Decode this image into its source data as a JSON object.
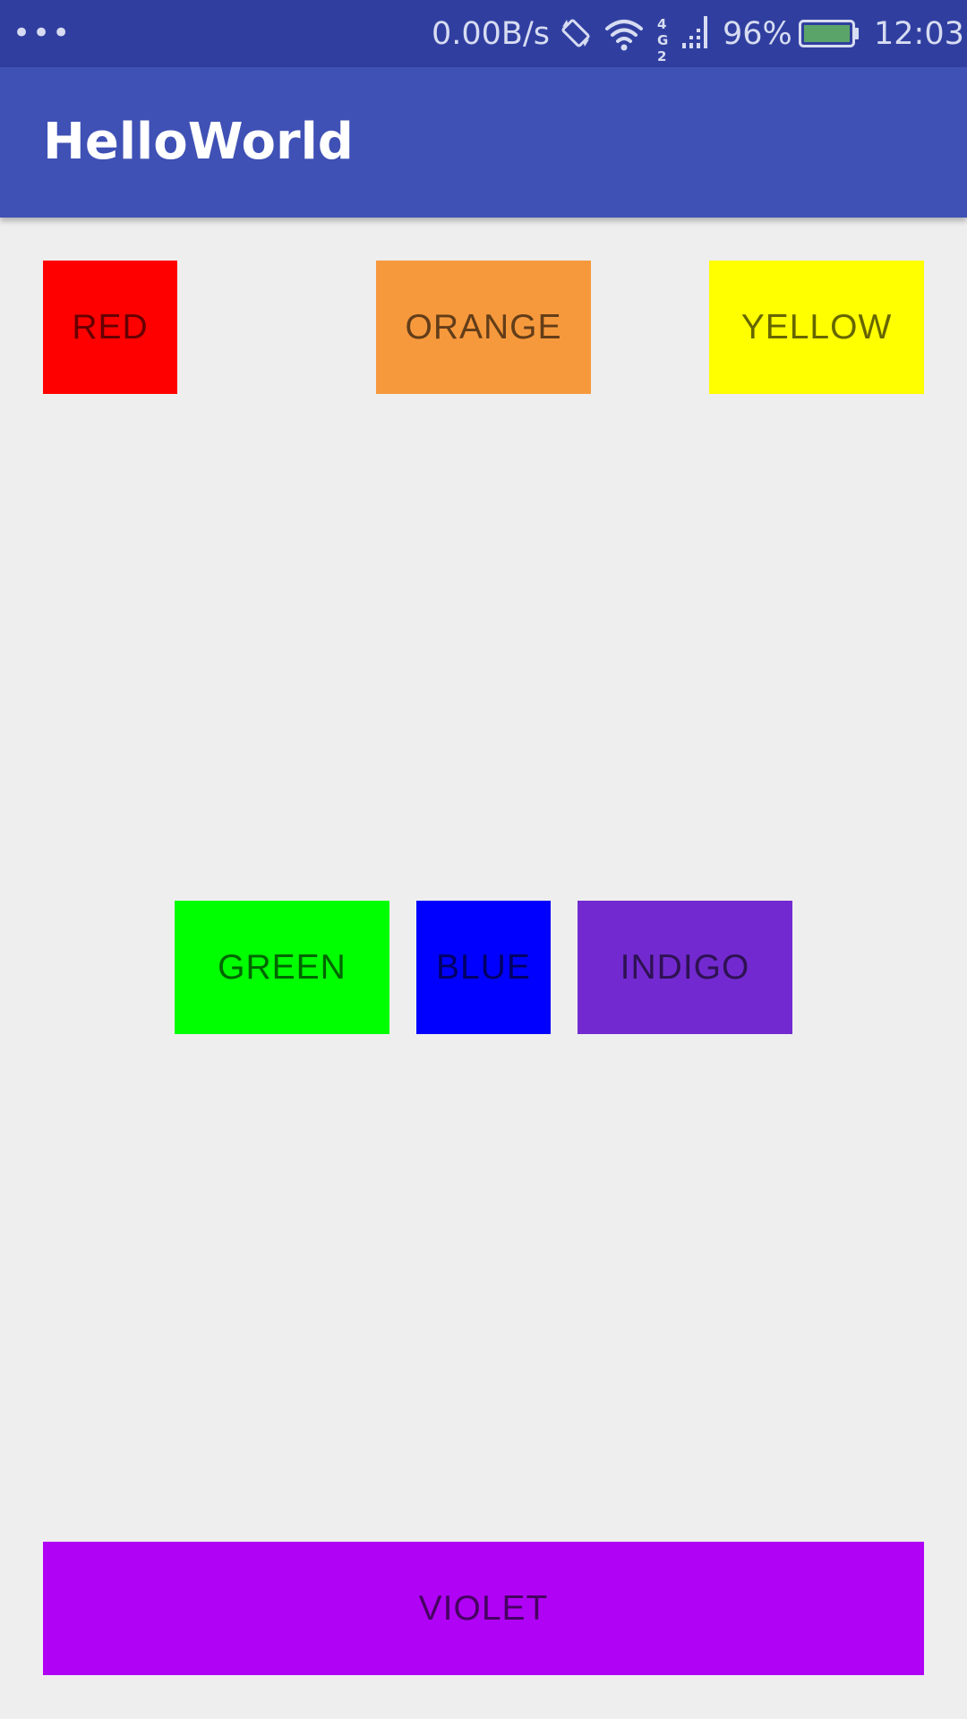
{
  "status_bar": {
    "menu_dots": "•••",
    "network_speed": "0.00B/s",
    "network_types": "4G 2G",
    "battery_percent": "96%",
    "time": "12:03",
    "icons": [
      "rotate-lock-icon",
      "wifi-icon",
      "cellular-signal-icon",
      "battery-icon"
    ],
    "background_color": "#303f9f"
  },
  "app_bar": {
    "title": "HelloWorld",
    "background_color": "#3f51b5"
  },
  "buttons": [
    {
      "label": "RED",
      "background": "#ff0000",
      "text_color": "#660000"
    },
    {
      "label": "ORANGE",
      "background": "#f6993d",
      "text_color": "#633d18"
    },
    {
      "label": "YELLOW",
      "background": "#ffff00",
      "text_color": "#666600"
    },
    {
      "label": "GREEN",
      "background": "#00ff00",
      "text_color": "#006600"
    },
    {
      "label": "BLUE",
      "background": "#0000ff",
      "text_color": "#000066"
    },
    {
      "label": "INDIGO",
      "background": "#722ad0",
      "text_color": "#2e1153"
    },
    {
      "label": "VIOLET",
      "background": "#b003f6",
      "text_color": "#460162"
    }
  ],
  "page_background": "#efeeef"
}
